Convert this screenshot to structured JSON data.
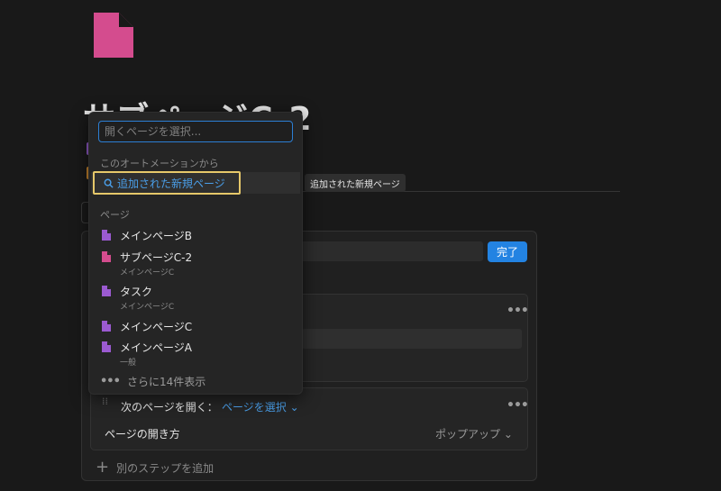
{
  "page": {
    "title": "サブページC-2",
    "icon": "document-icon",
    "icon_color": "#d44c8e"
  },
  "menu": {
    "search_placeholder": "開くページを選択...",
    "automation_section": "このオートメーションから",
    "automation_item": "追加された新規ページ",
    "pages_section": "ページ",
    "pages": [
      {
        "title": "メインページB",
        "subtitle": "",
        "icon_color": "#9b5ad1"
      },
      {
        "title": "サブページC-2",
        "subtitle": "メインページC",
        "icon_color": "#d44c8e"
      },
      {
        "title": "タスク",
        "subtitle": "メインページC",
        "icon_color": "#9b5ad1"
      },
      {
        "title": "メインページC",
        "subtitle": "",
        "icon_color": "#9b5ad1"
      },
      {
        "title": "メインページA",
        "subtitle": "一般",
        "icon_color": "#9b5ad1"
      }
    ],
    "more_label": "さらに14件表示"
  },
  "tooltip": "追加された新規ページ",
  "editor": {
    "done_label": "完了",
    "step_open_label": "次のページを開く：",
    "step_select_page": "ページを選択",
    "open_method_label": "ページの開き方",
    "open_method_value": "ポップアップ",
    "add_step_label": "別のステップを追加"
  },
  "colors": {
    "accent": "#2383e2",
    "link": "#4a9ee8",
    "highlight": "#e6c86a"
  }
}
